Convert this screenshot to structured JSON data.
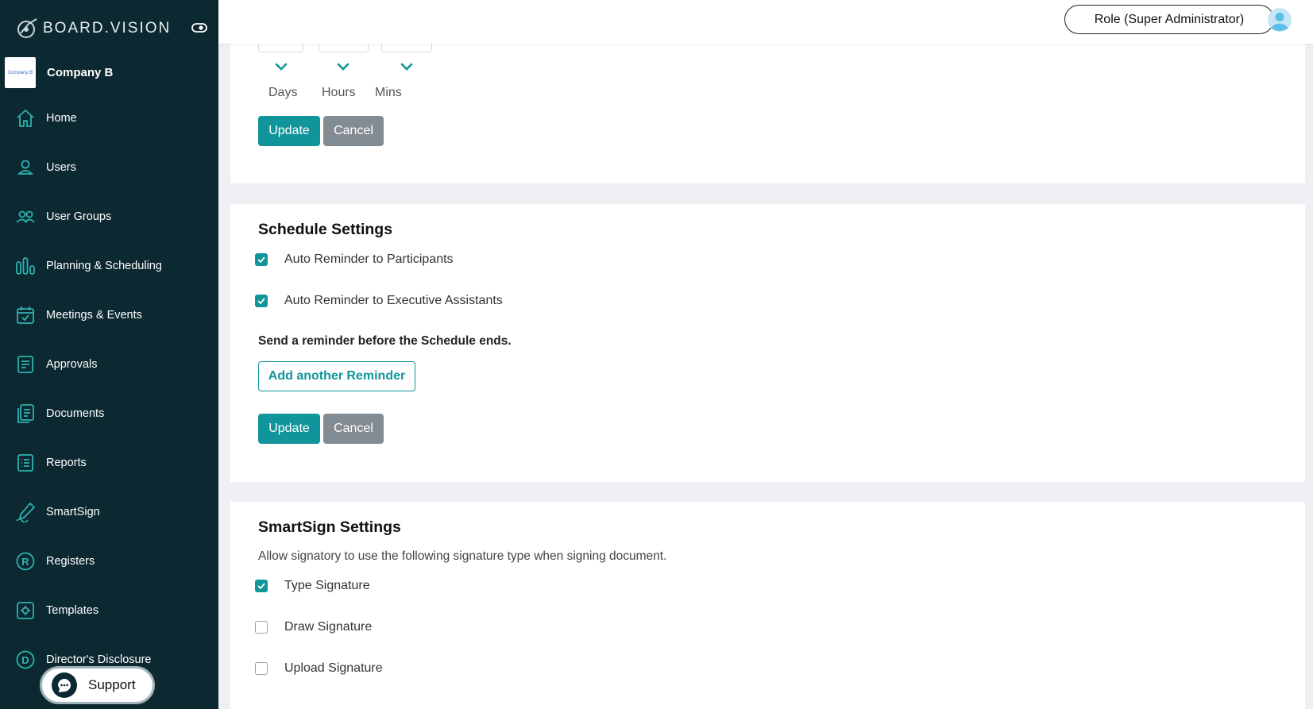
{
  "brand": {
    "name": "BOARD.VISION"
  },
  "company": {
    "name": "Company B",
    "logo_text": "Company B"
  },
  "nav": [
    {
      "label": "Home",
      "icon": "home-icon"
    },
    {
      "label": "Users",
      "icon": "user-icon"
    },
    {
      "label": "User Groups",
      "icon": "users-icon"
    },
    {
      "label": "Planning & Scheduling",
      "icon": "bars-chart-icon"
    },
    {
      "label": "Meetings & Events",
      "icon": "calendar-check-icon"
    },
    {
      "label": "Approvals",
      "icon": "approval-doc-icon"
    },
    {
      "label": "Documents",
      "icon": "documents-icon"
    },
    {
      "label": "Reports",
      "icon": "report-list-icon"
    },
    {
      "label": "SmartSign",
      "icon": "pen-sign-icon"
    },
    {
      "label": "Registers",
      "icon": "registered-icon"
    },
    {
      "label": "Templates",
      "icon": "template-gear-icon"
    },
    {
      "label": "Director's Disclosure",
      "icon": "disclosure-d-icon"
    }
  ],
  "support": {
    "label": "Support"
  },
  "topbar": {
    "role": "Role (Super Administrator)"
  },
  "duration": {
    "days_label": "Days",
    "hours_label": "Hours",
    "mins_label": "Mins"
  },
  "buttons": {
    "update": "Update",
    "cancel": "Cancel",
    "add_reminder": "Add another Reminder"
  },
  "schedule": {
    "title": "Schedule Settings",
    "options": [
      {
        "label": "Auto Reminder to Participants",
        "checked": true
      },
      {
        "label": "Auto Reminder to Executive Assistants",
        "checked": true
      }
    ],
    "reminder_text": "Send a reminder before the Schedule ends."
  },
  "smartsign": {
    "title": "SmartSign Settings",
    "description": "Allow signatory to use the following signature type when signing document.",
    "options": [
      {
        "label": "Type Signature",
        "checked": true
      },
      {
        "label": "Draw Signature",
        "checked": false
      },
      {
        "label": "Upload Signature",
        "checked": false
      }
    ]
  },
  "colors": {
    "sidebar": "#0c2830",
    "accent": "#10959b",
    "secondary_button": "#848c93"
  }
}
